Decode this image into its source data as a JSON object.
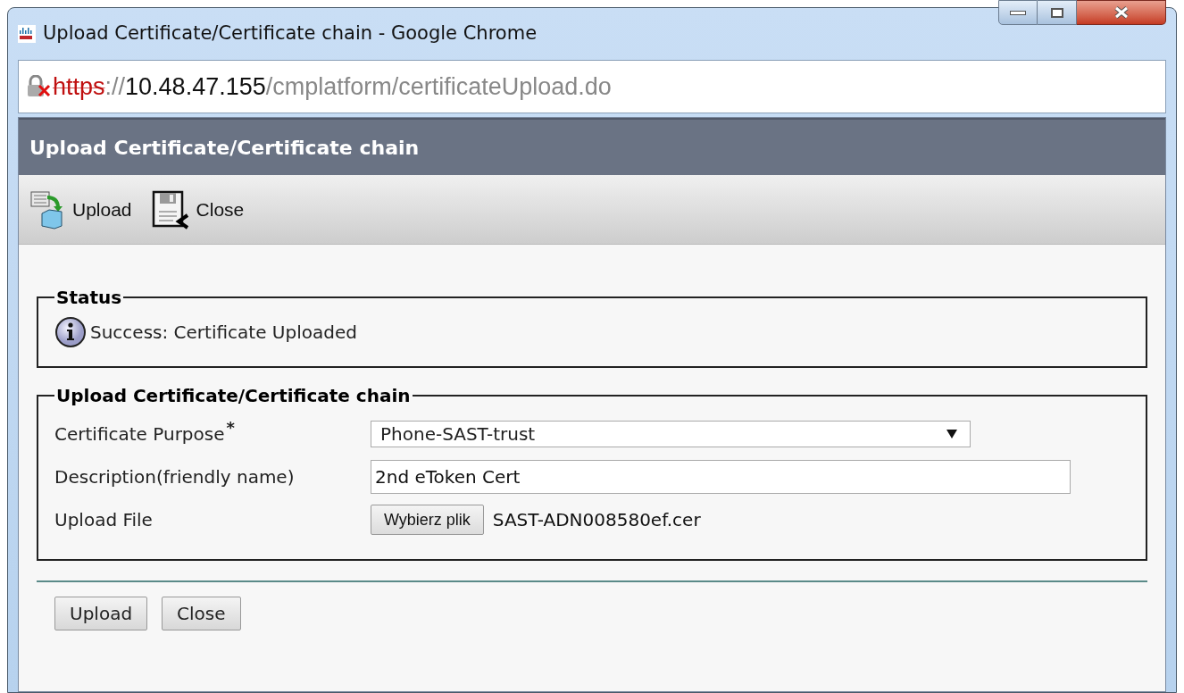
{
  "window": {
    "title": "Upload Certificate/Certificate chain - Google Chrome"
  },
  "address_bar": {
    "scheme": "https",
    "separator": "://",
    "host": "10.48.47.155",
    "path": "/cmplatform/certificateUpload.do",
    "insecure": true
  },
  "header": {
    "title": "Upload Certificate/Certificate chain"
  },
  "toolbar": [
    {
      "kind": "upload",
      "label": "Upload"
    },
    {
      "kind": "close",
      "label": "Close"
    }
  ],
  "status": {
    "legend": "Status",
    "message": "Success: Certificate Uploaded"
  },
  "form": {
    "legend": "Upload Certificate/Certificate chain",
    "fields": [
      {
        "kind": "select",
        "label": "Certificate Purpose",
        "required_mark": "*",
        "value": "Phone-SAST-trust"
      },
      {
        "kind": "text",
        "label": "Description(friendly name)",
        "value": "2nd eToken Cert"
      },
      {
        "kind": "file",
        "label": "Upload File",
        "button": "Wybierz plik",
        "file_name": "SAST-ADN008580ef.cer"
      }
    ]
  },
  "buttons": [
    "Upload",
    "Close"
  ]
}
